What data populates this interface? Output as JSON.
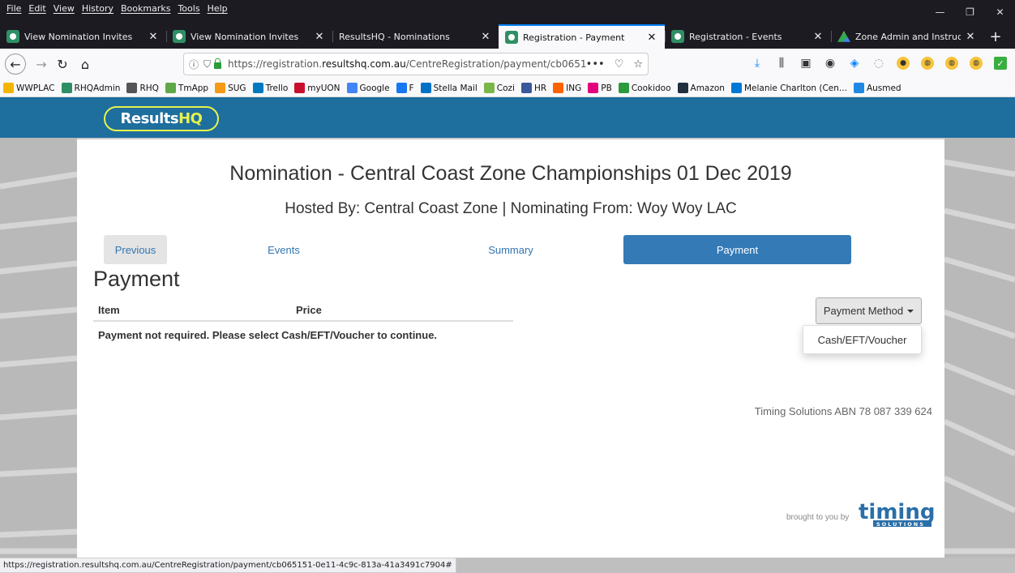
{
  "menu": [
    "File",
    "Edit",
    "View",
    "History",
    "Bookmarks",
    "Tools",
    "Help"
  ],
  "window_controls": [
    "—",
    "❐",
    "✕"
  ],
  "tabs": [
    {
      "label": "View Nomination Invites",
      "icon": "rhq-favicon-icon"
    },
    {
      "label": "View Nomination Invites",
      "icon": "rhq-favicon-icon"
    },
    {
      "label": "ResultsHQ - Nominations",
      "icon": "none"
    },
    {
      "label": "Registration - Payment",
      "icon": "rhq-favicon-icon",
      "active": true
    },
    {
      "label": "Registration - Events",
      "icon": "rhq-favicon-icon"
    },
    {
      "label": "Zone Admin and Instructions -",
      "icon": "google-drive-icon"
    }
  ],
  "url": {
    "prefix": "https://registration.",
    "domain": "resultshq.com.au",
    "path": "/CentreRegistration/payment/cb065151"
  },
  "bookmarks": [
    {
      "label": "WWPLAC",
      "color": "#f5b400"
    },
    {
      "label": "RHQAdmin",
      "color": "#2f8f64"
    },
    {
      "label": "RHQ",
      "color": "#555555"
    },
    {
      "label": "TmApp",
      "color": "#5fa84a"
    },
    {
      "label": "SUG",
      "color": "#f59a16"
    },
    {
      "label": "Trello",
      "color": "#0079bf"
    },
    {
      "label": "myUON",
      "color": "#c8102e"
    },
    {
      "label": "Google",
      "color": "#4285f4"
    },
    {
      "label": "F",
      "color": "#1877f2"
    },
    {
      "label": "Stella Mail",
      "color": "#0072c6"
    },
    {
      "label": "Cozi",
      "color": "#7ab648"
    },
    {
      "label": "HR",
      "color": "#3b5998"
    },
    {
      "label": "ING",
      "color": "#ff6200"
    },
    {
      "label": "PB",
      "color": "#e4007c"
    },
    {
      "label": "Cookidoo",
      "color": "#2b9a3e"
    },
    {
      "label": "Amazon",
      "color": "#232f3e"
    },
    {
      "label": "Melanie Charlton (Cen...",
      "color": "#0078d4"
    },
    {
      "label": "Ausmed",
      "color": "#1e88e5"
    }
  ],
  "site": {
    "logo_results": "Results",
    "logo_hq": "HQ",
    "title": "Nomination - Central Coast Zone Championships 01 Dec 2019",
    "subtitle": "Hosted By: Central Coast Zone | Nominating From: Woy Woy LAC",
    "steps": {
      "previous": "Previous",
      "events": "Events",
      "summary": "Summary",
      "payment": "Payment"
    },
    "heading": "Payment",
    "table": {
      "col_item": "Item",
      "col_price": "Price",
      "message": "Payment not required. Please select Cash/EFT/Voucher to continue."
    },
    "payment_method_label": "Payment Method",
    "dropdown_options": [
      "Cash/EFT/Voucher"
    ],
    "abn": "Timing Solutions ABN 78 087 339 624",
    "brought_to_you_by": "brought to you by",
    "timing_logo_text": "timing",
    "timing_logo_sub": "SOLUTIONS"
  },
  "status_url": "https://registration.resultshq.com.au/CentreRegistration/payment/cb065151-0e11-4c9c-813a-41a3491c7904#",
  "colors": {
    "header_blue": "#1e6e9e",
    "active_step": "#337ab7",
    "logo_yellow": "#e8f24a",
    "link_blue": "#3276b1"
  }
}
